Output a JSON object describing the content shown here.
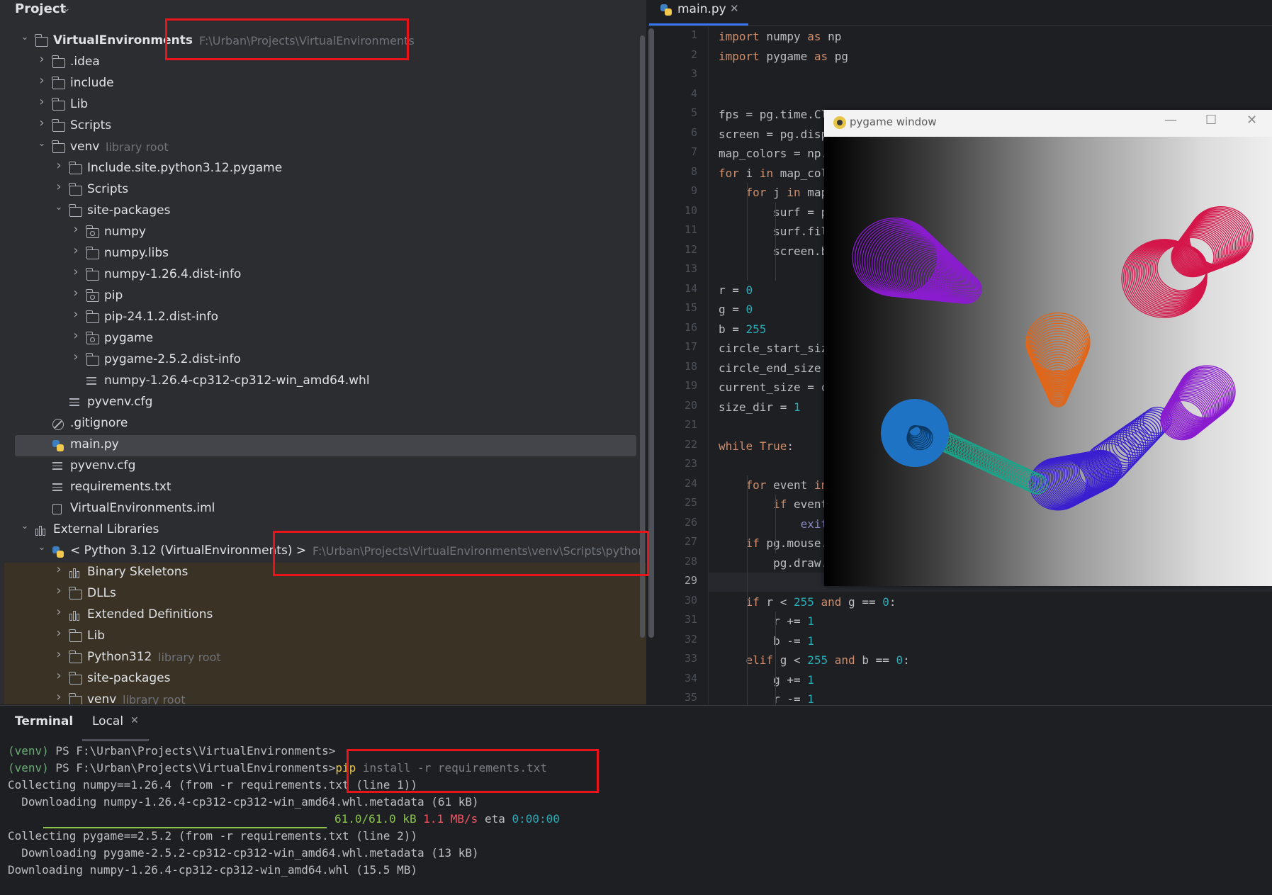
{
  "project": {
    "title": "Project",
    "tree": [
      {
        "label": "VirtualEnvironments",
        "hint": "F:\\Urban\\Projects\\VirtualEnvironments",
        "type": "root-module",
        "bold": true,
        "expanded": true,
        "depth": 0
      },
      {
        "label": ".idea",
        "type": "folder",
        "depth": 1,
        "expanded": false
      },
      {
        "label": "include",
        "type": "folder",
        "depth": 1,
        "expanded": false
      },
      {
        "label": "Lib",
        "type": "folder",
        "depth": 1,
        "expanded": false
      },
      {
        "label": "Scripts",
        "type": "folder",
        "depth": 1,
        "expanded": false
      },
      {
        "label": "venv",
        "hint": "library root",
        "type": "folder",
        "depth": 1,
        "expanded": true
      },
      {
        "label": "Include.site.python3.12.pygame",
        "type": "folder",
        "depth": 2,
        "expanded": false
      },
      {
        "label": "Scripts",
        "type": "folder",
        "depth": 2,
        "expanded": false
      },
      {
        "label": "site-packages",
        "type": "folder",
        "depth": 2,
        "expanded": true
      },
      {
        "label": "numpy",
        "type": "package",
        "depth": 3,
        "expanded": false
      },
      {
        "label": "numpy.libs",
        "type": "folder",
        "depth": 3,
        "expanded": false
      },
      {
        "label": "numpy-1.26.4.dist-info",
        "type": "folder",
        "depth": 3,
        "expanded": false
      },
      {
        "label": "pip",
        "type": "package",
        "depth": 3,
        "expanded": false
      },
      {
        "label": "pip-24.1.2.dist-info",
        "type": "folder",
        "depth": 3,
        "expanded": false
      },
      {
        "label": "pygame",
        "type": "package",
        "depth": 3,
        "expanded": false
      },
      {
        "label": "pygame-2.5.2.dist-info",
        "type": "folder",
        "depth": 3,
        "expanded": false
      },
      {
        "label": "numpy-1.26.4-cp312-cp312-win_amd64.whl",
        "type": "file",
        "depth": 3
      },
      {
        "label": "pyvenv.cfg",
        "type": "file",
        "depth": 2
      },
      {
        "label": ".gitignore",
        "type": "ignore",
        "depth": 1
      },
      {
        "label": "main.py",
        "type": "python",
        "depth": 1,
        "selected": true
      },
      {
        "label": "pyvenv.cfg",
        "type": "file",
        "depth": 1
      },
      {
        "label": "requirements.txt",
        "type": "file",
        "depth": 1
      },
      {
        "label": "VirtualEnvironments.iml",
        "type": "iml",
        "depth": 1
      },
      {
        "label": "External Libraries",
        "type": "library",
        "depth": 0,
        "expanded": true
      },
      {
        "label": "< Python 3.12 (VirtualEnvironments) >",
        "hint": "F:\\Urban\\Projects\\VirtualEnvironments\\venv\\Scripts\\python.exe",
        "type": "python",
        "depth": 1,
        "expanded": true
      },
      {
        "label": "Binary Skeletons",
        "type": "library",
        "depth": 2,
        "expanded": false,
        "ext": true
      },
      {
        "label": "DLLs",
        "type": "folder",
        "depth": 2,
        "expanded": false,
        "ext": true
      },
      {
        "label": "Extended Definitions",
        "type": "library",
        "depth": 2,
        "expanded": false,
        "ext": true
      },
      {
        "label": "Lib",
        "type": "folder",
        "depth": 2,
        "expanded": false,
        "ext": true
      },
      {
        "label": "Python312",
        "hint": "library root",
        "type": "folder",
        "depth": 2,
        "expanded": false,
        "ext": true
      },
      {
        "label": "site-packages",
        "type": "folder",
        "depth": 2,
        "expanded": false,
        "ext": true
      },
      {
        "label": "venv",
        "hint": "library root",
        "type": "folder",
        "depth": 2,
        "expanded": false,
        "ext": true
      }
    ]
  },
  "editor": {
    "tab_label": "main.py",
    "current_line": 29,
    "lines": [
      [
        [
          "kw",
          "import"
        ],
        [
          "t",
          " numpy "
        ],
        [
          "kw",
          "as"
        ],
        [
          "t",
          " np"
        ]
      ],
      [
        [
          "kw",
          "import"
        ],
        [
          "t",
          " pygame "
        ],
        [
          "kw",
          "as"
        ],
        [
          "t",
          " pg"
        ]
      ],
      [],
      [],
      [
        [
          "t",
          "fps = pg.time.Cl"
        ]
      ],
      [
        [
          "t",
          "screen = pg.disp"
        ]
      ],
      [
        [
          "t",
          "map_colors = np.a"
        ]
      ],
      [
        [
          "kw",
          "for"
        ],
        [
          "t",
          " i "
        ],
        [
          "kw",
          "in"
        ],
        [
          "t",
          " map_col"
        ]
      ],
      [
        [
          "t",
          "    "
        ],
        [
          "kw",
          "for"
        ],
        [
          "t",
          " j "
        ],
        [
          "kw",
          "in"
        ],
        [
          "t",
          " map_"
        ]
      ],
      [
        [
          "t",
          "        surf = pe"
        ]
      ],
      [
        [
          "t",
          "        surf.fil"
        ]
      ],
      [
        [
          "t",
          "        screen.bl"
        ]
      ],
      [],
      [
        [
          "t",
          "r = "
        ],
        [
          "num",
          "0"
        ]
      ],
      [
        [
          "t",
          "g = "
        ],
        [
          "num",
          "0"
        ]
      ],
      [
        [
          "t",
          "b = "
        ],
        [
          "num",
          "255"
        ]
      ],
      [
        [
          "t",
          "circle_start_size"
        ]
      ],
      [
        [
          "t",
          "circle_end_size ="
        ]
      ],
      [
        [
          "t",
          "current_size = ci"
        ]
      ],
      [
        [
          "t",
          "size_dir = "
        ],
        [
          "num",
          "1"
        ]
      ],
      [],
      [
        [
          "kw",
          "while"
        ],
        [
          "t",
          " "
        ],
        [
          "kw",
          "True"
        ],
        [
          "t",
          ":"
        ]
      ],
      [],
      [
        [
          "t",
          "    "
        ],
        [
          "kw",
          "for"
        ],
        [
          "t",
          " event "
        ],
        [
          "kw",
          "in"
        ]
      ],
      [
        [
          "t",
          "        "
        ],
        [
          "kw",
          "if"
        ],
        [
          "t",
          " event"
        ]
      ],
      [
        [
          "t",
          "            "
        ],
        [
          "bi",
          "exit"
        ]
      ],
      [
        [
          "t",
          "    "
        ],
        [
          "kw",
          "if"
        ],
        [
          "t",
          " pg.mouse."
        ]
      ],
      [
        [
          "t",
          "        pg.draw."
        ]
      ],
      [],
      [
        [
          "t",
          "    "
        ],
        [
          "kw",
          "if"
        ],
        [
          "t",
          " r < "
        ],
        [
          "num",
          "255"
        ],
        [
          "t",
          " "
        ],
        [
          "kw",
          "and"
        ],
        [
          "t",
          " g == "
        ],
        [
          "num",
          "0"
        ],
        [
          "t",
          ":"
        ]
      ],
      [
        [
          "t",
          "        r += "
        ],
        [
          "num",
          "1"
        ]
      ],
      [
        [
          "t",
          "        b -= "
        ],
        [
          "num",
          "1"
        ]
      ],
      [
        [
          "t",
          "    "
        ],
        [
          "kw",
          "elif"
        ],
        [
          "t",
          " g < "
        ],
        [
          "num",
          "255"
        ],
        [
          "t",
          " "
        ],
        [
          "kw",
          "and"
        ],
        [
          "t",
          " b == "
        ],
        [
          "num",
          "0"
        ],
        [
          "t",
          ":"
        ]
      ],
      [
        [
          "t",
          "        g += "
        ],
        [
          "num",
          "1"
        ]
      ],
      [
        [
          "t",
          "        r -= "
        ],
        [
          "num",
          "1"
        ]
      ]
    ]
  },
  "pygame_window": {
    "title": "pygame window",
    "controls": {
      "minimize": "—",
      "maximize": "☐",
      "close": "✕"
    },
    "swirl_colors": [
      "#8a1ccf",
      "#d4164a",
      "#e0661a",
      "#1f73c4",
      "#1aa58a",
      "#3a1fd0"
    ]
  },
  "terminal": {
    "title": "Terminal",
    "tab_label": "Local",
    "venv": "(venv)",
    "prompt": " PS F:\\Urban\\Projects\\VirtualEnvironments>",
    "cmd_pip": "pip",
    "cmd_install": " install ",
    "cmd_flag": "-r",
    "cmd_file": " requirements.txt",
    "line_collect_numpy": "Collecting numpy==1.26.4 (from -r requirements.txt (line 1))",
    "line_dl_numpy_meta": "  Downloading numpy-1.26.4-cp312-cp312-win_amd64.whl.metadata (61 kB)",
    "progress_size": "61.0/61.0 kB",
    "progress_speed": "1.1 MB/s",
    "progress_eta_label": "eta",
    "progress_eta": "0:00:00",
    "progress_fraction": 1.0,
    "line_collect_pygame": "Collecting pygame==2.5.2 (from -r requirements.txt (line 2))",
    "line_dl_pygame_meta": "  Downloading pygame-2.5.2-cp312-cp312-win_amd64.whl.metadata (13 kB)",
    "line_dl_numpy_whl": "Downloading numpy-1.26.4-cp312-cp312-win_amd64.whl (15.5 MB)"
  }
}
